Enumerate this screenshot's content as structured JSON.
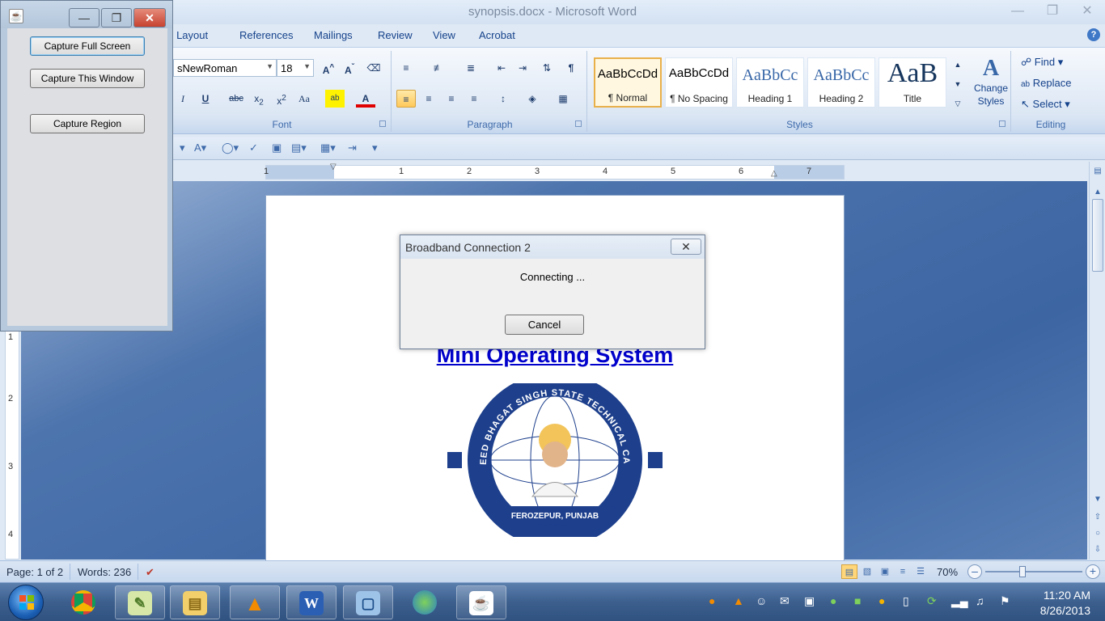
{
  "word": {
    "title": "synopsis.docx - Microsoft Word",
    "tabs": [
      "ge Layout",
      "References",
      "Mailings",
      "Review",
      "View",
      "Acrobat"
    ],
    "font_name": "sNewRoman",
    "font_size": "18",
    "groups": {
      "font": "Font",
      "paragraph": "Paragraph",
      "styles": "Styles",
      "editing": "Editing"
    },
    "styles": [
      {
        "preview": "AaBbCcDd",
        "name": "¶ Normal"
      },
      {
        "preview": "AaBbCcDd",
        "name": "¶ No Spacing"
      },
      {
        "preview": "AaBbCc",
        "name": "Heading 1"
      },
      {
        "preview": "AaBbCc",
        "name": "Heading 2"
      },
      {
        "preview": "AaB",
        "name": "Title"
      }
    ],
    "change_styles": "Change Styles",
    "editing": {
      "find": "Find",
      "replace": "Replace",
      "select": "Select"
    },
    "ruler_numbers": [
      "1",
      "1",
      "2",
      "3",
      "4",
      "5",
      "6",
      "7"
    ],
    "ruler_v_numbers": [
      "1",
      "2",
      "3",
      "4"
    ],
    "document_title": "Mini Operating System",
    "logo": {
      "top_text": "SHAHEED BHAGAT SINGH STATE TECHNICAL CAMPUS",
      "bottom_text": "FEROZEPUR, PUNJAB"
    },
    "status": {
      "page": "Page: 1 of 2",
      "words": "Words: 236",
      "zoom": "70%",
      "zoom_fraction": 0.7
    }
  },
  "capture": {
    "buttons": [
      "Capture Full Screen",
      "Capture This Window",
      "Capture Region"
    ]
  },
  "dialog": {
    "title": "Broadband Connection 2",
    "message": "Connecting ...",
    "cancel": "Cancel"
  },
  "taskbar": {
    "apps": [
      "chrome-icon",
      "notepad-icon",
      "explorer-icon",
      "vlc-icon",
      "word-icon",
      "virtualbox-icon",
      "network-icon",
      "java-icon"
    ],
    "time": "11:20 AM",
    "date": "8/26/2013"
  },
  "colors": {
    "doc_title": "#0000cc",
    "accent": "#15428b",
    "taskbar": "#3c5f8e"
  }
}
